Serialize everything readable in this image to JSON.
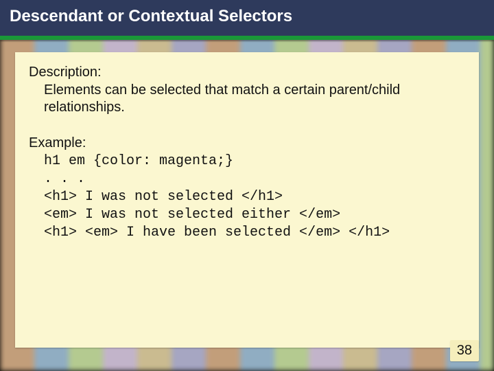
{
  "title": "Descendant or Contextual Selectors",
  "description": {
    "label": "Description:",
    "text": "Elements can be selected that match a certain parent/child relationships."
  },
  "example": {
    "label": "Example:",
    "lines": {
      "l1": "h1 em {color: magenta;}",
      "l2": ". . .",
      "l3": "<h1> I was not selected </h1>",
      "l4": "<em> I was not selected either </em>",
      "l5": "<h1> <em> I have been selected </em> </h1>"
    }
  },
  "page_number": "38"
}
